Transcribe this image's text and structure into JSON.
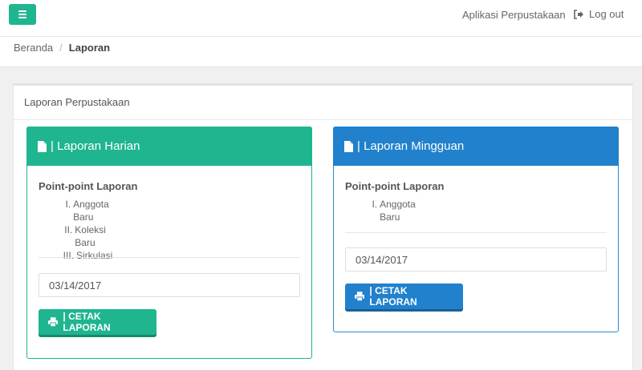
{
  "navbar": {
    "app_name": "Aplikasi Perpustakaan",
    "logout_label": "Log out"
  },
  "breadcrumb": {
    "home": "Beranda",
    "separator": "/",
    "current": "Laporan"
  },
  "panel": {
    "title": "Laporan Perpustakaan"
  },
  "cards": [
    {
      "title": "| Laporan Harian",
      "points_title": "Point-point Laporan",
      "points": [
        {
          "num": "I.",
          "label": "Anggota Baru"
        },
        {
          "num": "II.",
          "label": "Koleksi Baru"
        },
        {
          "num": "III.",
          "label": "Sirkulasi"
        }
      ],
      "date_value": "03/14/2017",
      "print_label": "| CETAK LAPORAN"
    },
    {
      "title": "| Laporan Mingguan",
      "points_title": "Point-point Laporan",
      "points": [
        {
          "num": "I.",
          "label": "Anggota Baru"
        }
      ],
      "date_value": "03/14/2017",
      "print_label": "| CETAK LAPORAN"
    }
  ],
  "colors": {
    "green": "#1fb58f",
    "blue": "#2181cc"
  },
  "icons": [
    "menu-icon",
    "logout-icon",
    "document-icon",
    "print-icon"
  ]
}
